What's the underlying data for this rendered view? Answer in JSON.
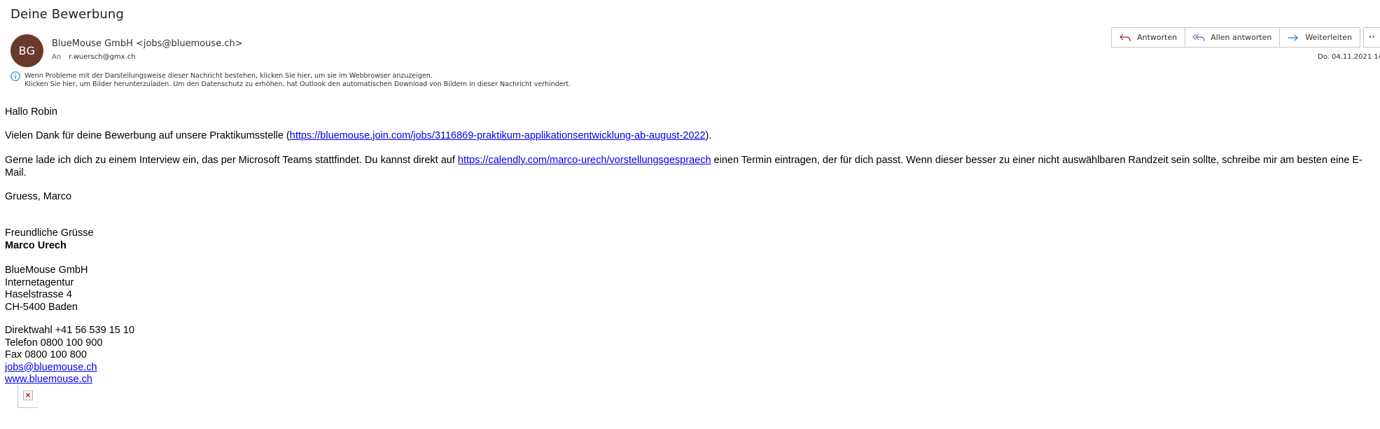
{
  "message": {
    "subject": "Deine Bewerbung",
    "avatar_initials": "BG",
    "avatar_color": "#6b3a2c",
    "sender": "BlueMouse GmbH <jobs@bluemouse.ch>",
    "to_label": "An",
    "to_address": "r.wuersch@gmx.ch",
    "date": "Do. 04.11.2021 14"
  },
  "actions": {
    "reply_label": "Antworten",
    "reply_all_label": "Allen antworten",
    "forward_label": "Weiterleiten",
    "more_label": "··"
  },
  "info": {
    "line1": "Wenn Probleme mit der Darstellungsweise dieser Nachricht bestehen, klicken Sie hier, um sie im Webbrowser anzuzeigen.",
    "line2": "Klicken Sie hier, um Bilder herunterzuladen. Um den Datenschutz zu erhöhen, hat Outlook den automatischen Download von Bildern in dieser Nachricht verhindert."
  },
  "body": {
    "greeting": "Hallo Robin",
    "thanks_before": "Vielen Dank für deine Bewerbung auf unsere Praktikumsstelle (",
    "thanks_link": "https://bluemouse.join.com/jobs/3116869-praktikum-applikationsentwicklung-ab-august-2022",
    "thanks_after": ").",
    "invite_before": "Gerne lade ich dich zu einem Interview ein, das per Microsoft Teams stattfindet. Du kannst direkt auf ",
    "invite_link": "https://calendly.com/marco-urech/vorstellungsgespraech",
    "invite_after": " einen Termin eintragen, der für dich passt. Wenn dieser besser zu einer nicht auswählbaren Randzeit sein sollte, schreibe mir am besten eine E-Mail.",
    "signoff": "Gruess, Marco"
  },
  "signature": {
    "closing": "Freundliche Grüsse",
    "name": "Marco Urech",
    "company": "BlueMouse GmbH",
    "type": "Internetagentur",
    "street": "Haselstrasse 4",
    "city": "CH-5400 Baden",
    "direct": "Direktwahl +41 56 539 15 10",
    "phone": "Telefon 0800 100 900",
    "fax": "Fax 0800 100 800",
    "email": "jobs@bluemouse.ch",
    "web": "www.bluemouse.ch"
  },
  "colors": {
    "accent": "#0078d4",
    "reply_icon": "#a4262c",
    "reply_all_icon": "#8764b8",
    "forward_icon": "#0078d4",
    "link": "#0000ee"
  }
}
